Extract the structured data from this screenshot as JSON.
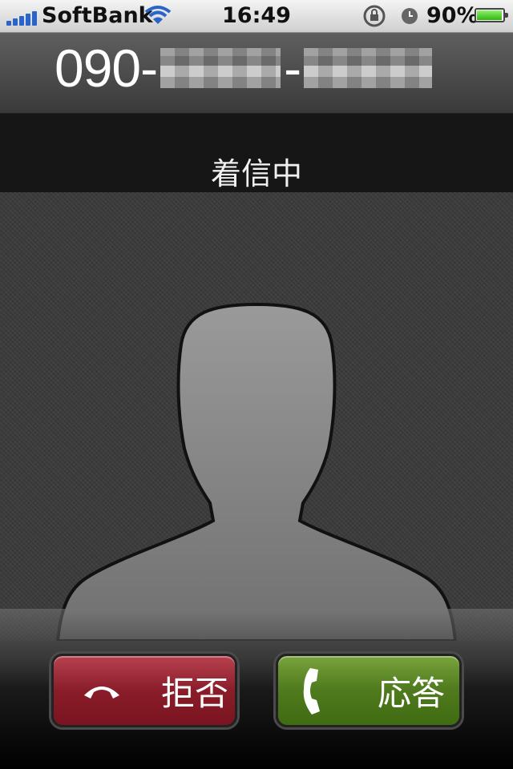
{
  "status_bar": {
    "carrier": "SoftBank",
    "time": "16:49",
    "battery_percent": "90%",
    "battery_level": 0.9,
    "icons": [
      "signal-icon",
      "wifi-icon",
      "orientation-lock-icon",
      "alarm-icon",
      "battery-icon"
    ]
  },
  "caller": {
    "number_prefix": "090-",
    "number_separator": "-"
  },
  "call": {
    "status": "着信中"
  },
  "actions": {
    "decline_label": "拒否",
    "answer_label": "応答"
  },
  "colors": {
    "decline": "#8a1d2a",
    "answer": "#4f7a1d",
    "signal": "#2a64c9"
  }
}
